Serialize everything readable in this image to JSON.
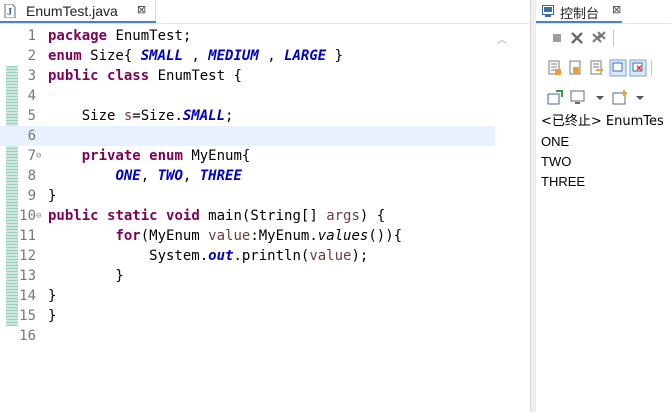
{
  "editor": {
    "tab": {
      "title": "EnumTest.java",
      "close_glyph": "⊠"
    },
    "lines": [
      {
        "num": "1",
        "tokens": [
          {
            "t": "package",
            "c": "kw"
          },
          {
            "t": " EnumTest;",
            "c": ""
          }
        ]
      },
      {
        "num": "2",
        "tokens": [
          {
            "t": "enum",
            "c": "kw"
          },
          {
            "t": " Size{ ",
            "c": ""
          },
          {
            "t": "SMALL",
            "c": "en"
          },
          {
            "t": " , ",
            "c": ""
          },
          {
            "t": "MEDIUM",
            "c": "en"
          },
          {
            "t": " , ",
            "c": ""
          },
          {
            "t": "LARGE",
            "c": "en"
          },
          {
            "t": " }",
            "c": ""
          }
        ]
      },
      {
        "num": "3",
        "tokens": [
          {
            "t": "public",
            "c": "kw"
          },
          {
            "t": " ",
            "c": ""
          },
          {
            "t": "class",
            "c": "kw"
          },
          {
            "t": " EnumTest {",
            "c": ""
          }
        ]
      },
      {
        "num": "4",
        "tokens": []
      },
      {
        "num": "5",
        "tokens": [
          {
            "t": "    Size ",
            "c": ""
          },
          {
            "t": "s",
            "c": "lv"
          },
          {
            "t": "=Size.",
            "c": ""
          },
          {
            "t": "SMALL",
            "c": "fi"
          },
          {
            "t": ";",
            "c": ""
          }
        ]
      },
      {
        "num": "6",
        "tokens": [],
        "current": true
      },
      {
        "num": "7",
        "fold": "⊖",
        "tokens": [
          {
            "t": "    ",
            "c": ""
          },
          {
            "t": "private",
            "c": "kw"
          },
          {
            "t": " ",
            "c": ""
          },
          {
            "t": "enum",
            "c": "kw"
          },
          {
            "t": " MyEnum{",
            "c": ""
          }
        ]
      },
      {
        "num": "8",
        "tokens": [
          {
            "t": "        ",
            "c": ""
          },
          {
            "t": "ONE",
            "c": "en"
          },
          {
            "t": ", ",
            "c": ""
          },
          {
            "t": "TWO",
            "c": "en"
          },
          {
            "t": ", ",
            "c": ""
          },
          {
            "t": "THREE",
            "c": "en"
          }
        ]
      },
      {
        "num": "9",
        "tokens": [
          {
            "t": "}",
            "c": ""
          }
        ]
      },
      {
        "num": "10",
        "fold": "⊖",
        "tokens": [
          {
            "t": "public",
            "c": "kw"
          },
          {
            "t": " ",
            "c": ""
          },
          {
            "t": "static",
            "c": "kw"
          },
          {
            "t": " ",
            "c": ""
          },
          {
            "t": "void",
            "c": "kw"
          },
          {
            "t": " main(String[] ",
            "c": ""
          },
          {
            "t": "args",
            "c": "lv"
          },
          {
            "t": ") {",
            "c": ""
          }
        ]
      },
      {
        "num": "11",
        "tokens": [
          {
            "t": "        ",
            "c": ""
          },
          {
            "t": "for",
            "c": "kw"
          },
          {
            "t": "(MyEnum ",
            "c": ""
          },
          {
            "t": "value",
            "c": "lv"
          },
          {
            "t": ":MyEnum.",
            "c": ""
          },
          {
            "t": "values",
            "c": "it"
          },
          {
            "t": "()){",
            "c": ""
          }
        ]
      },
      {
        "num": "12",
        "tokens": [
          {
            "t": "            System.",
            "c": ""
          },
          {
            "t": "out",
            "c": "fi"
          },
          {
            "t": ".println(",
            "c": ""
          },
          {
            "t": "value",
            "c": "lv"
          },
          {
            "t": ");",
            "c": ""
          }
        ]
      },
      {
        "num": "13",
        "tokens": [
          {
            "t": "        }",
            "c": ""
          }
        ]
      },
      {
        "num": "14",
        "tokens": [
          {
            "t": "}",
            "c": ""
          }
        ]
      },
      {
        "num": "15",
        "tokens": [
          {
            "t": "}",
            "c": ""
          }
        ]
      },
      {
        "num": "16",
        "tokens": []
      }
    ]
  },
  "console": {
    "title": "控制台",
    "close_glyph": "⊠",
    "status": "<已终止> EnumTes",
    "output": [
      "ONE",
      "TWO",
      "THREE"
    ]
  },
  "colors": {
    "keyword": "#7f0055",
    "enum_constant": "#0000c0",
    "local_var": "#6a3e3e",
    "current_line": "#e8f2fe",
    "active_tab": "#4a7fd1"
  }
}
